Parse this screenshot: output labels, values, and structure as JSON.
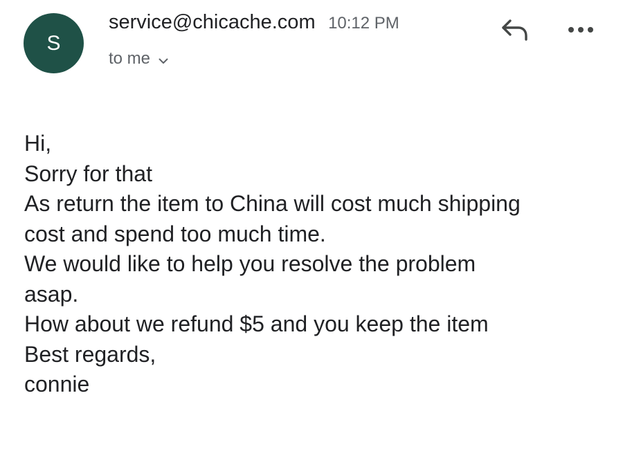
{
  "header": {
    "avatar_letter": "S",
    "sender": "service@chicache.com",
    "time": "10:12 PM",
    "recipient": "to me",
    "avatar_color": "#1f5147",
    "reply_icon": "reply-arrow",
    "more_icon": "horizontal-dots"
  },
  "message": {
    "lines": [
      "Hi,",
      "Sorry for that",
      "As return the item to China will cost much shipping",
      "cost and spend too much time.",
      "We would like to help you resolve the problem",
      "asap.",
      "How about we refund $5 and you keep the item",
      "Best regards,",
      "connie"
    ]
  }
}
